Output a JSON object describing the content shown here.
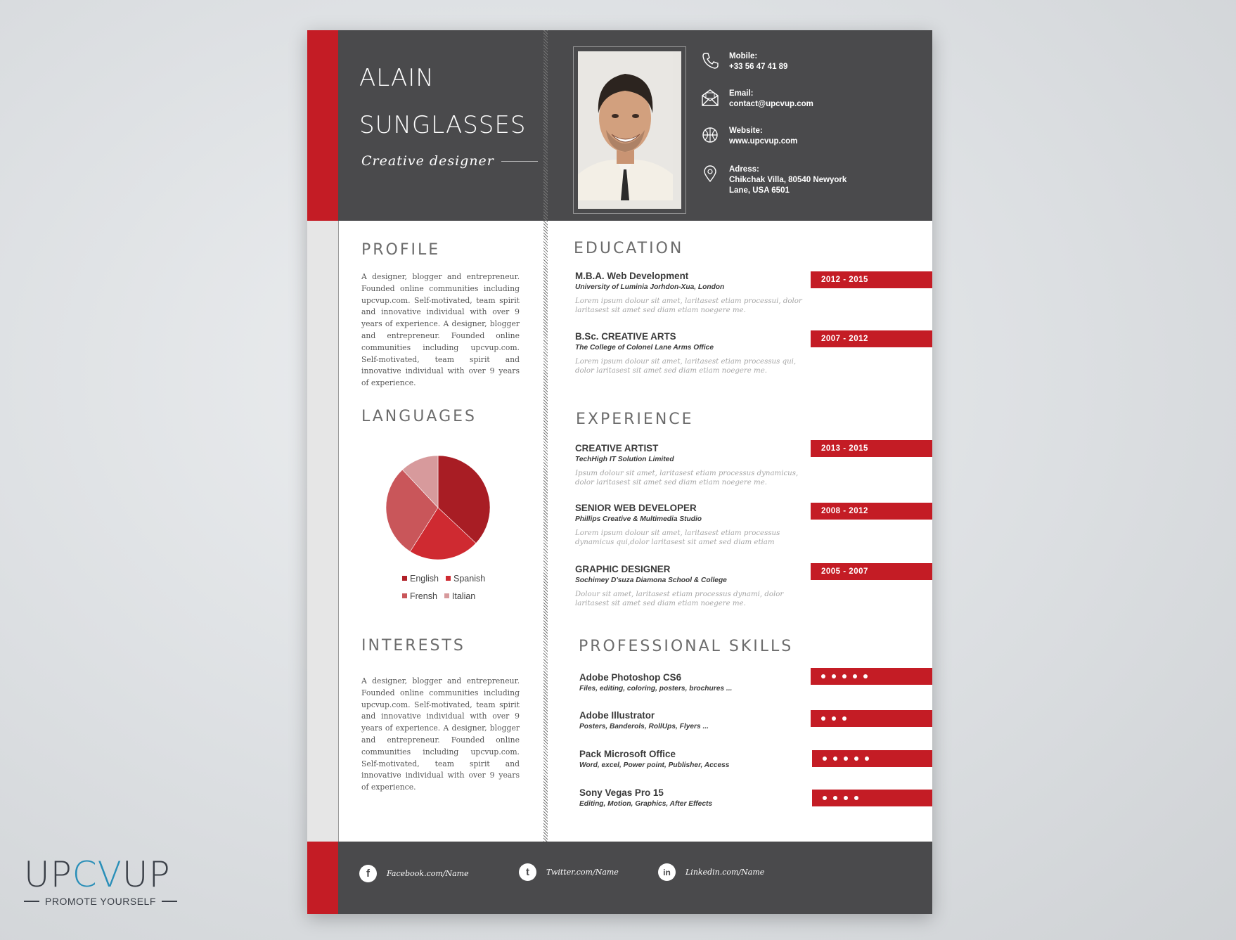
{
  "header": {
    "first_name": "ALAIN",
    "last_name": "SUNGLASSES",
    "role": "Creative designer"
  },
  "contact": [
    {
      "icon": "phone-icon",
      "label": "Mobile:",
      "value": "+33 56 47 41 89"
    },
    {
      "icon": "email-icon",
      "label": "Email:",
      "value": "contact@upcvup.com"
    },
    {
      "icon": "globe-icon",
      "label": "Website:",
      "value": "www.upcvup.com"
    },
    {
      "icon": "location-pin-icon",
      "label": "Adress:",
      "value": "Chikchak Villa, 80540 Newyork Lane, USA 6501"
    }
  ],
  "profile": {
    "title": "PROFILE",
    "text": "A designer, blogger and entrepreneur. Founded online communities including upcvup.com. Self-motivated, team spirit and innovative individual with over 9 years of experience. A designer, blogger and entrepreneur. Founded online communities including upcvup.com. Self-motivated, team spirit and innovative individual with over 9 years of experience."
  },
  "languages": {
    "title": "LANGUAGES",
    "legend": [
      "English",
      "Spanish",
      "Frensh",
      "Italian"
    ]
  },
  "chart_data": {
    "type": "pie",
    "categories": [
      "Spanish",
      "English",
      "Frensh",
      "Italian"
    ],
    "values": [
      37,
      22,
      29,
      12
    ],
    "colors": [
      "#a81d24",
      "#cf2a31",
      "#c9565a",
      "#d79a9c"
    ]
  },
  "interests": {
    "title": "INTERESTS",
    "text": "A designer, blogger and entrepreneur. Founded online communities including upcvup.com. Self-motivated, team spirit and innovative individual with over 9 years of experience. A designer, blogger and entrepreneur. Founded online communities including upcvup.com. Self-motivated, team spirit and innovative individual with over 9 years of experience."
  },
  "education": {
    "title": "EDUCATION",
    "items": [
      {
        "title": "M.B.A. Web Development",
        "org": "University of Luminia Jorhdon-Xua, London",
        "desc": "Lorem ipsum dolour sit amet, laritasest etiam processui, dolor laritasest  sit amet sed diam etiam noegere me.",
        "dates": "2012 - 2015"
      },
      {
        "title": "B.Sc. CREATIVE ARTS",
        "org": "The College of Colonel Lane Arms Office",
        "desc": "Lorem ipsum dolour sit amet, laritasest etiam processus qui, dolor laritasest  sit amet sed diam etiam noegere me.",
        "dates": "2007 - 2012"
      }
    ]
  },
  "experience": {
    "title": "EXPERIENCE",
    "items": [
      {
        "title": "CREATIVE ARTIST",
        "org": "TechHigh IT Solution Limited",
        "desc": "Ipsum dolour sit amet, laritasest etiam processus dynamicus, dolor laritasest  sit amet sed diam etiam noegere me.",
        "dates": "2013 - 2015"
      },
      {
        "title": "SENIOR WEB DEVELOPER",
        "org": "Phillips Creative & Multimedia Studio",
        "desc": "Lorem ipsum dolour sit amet, laritasest etiam processus dynamicus qui,dolor laritasest  sit amet sed diam etiam",
        "dates": "2008 - 2012"
      },
      {
        "title": "GRAPHIC DESIGNER",
        "org": "Sochimey D'suza Diamona School & College",
        "desc": "Dolour sit amet, laritasest etiam processus dynami, dolor laritasest  sit amet sed diam etiam noegere me.",
        "dates": "2005 - 2007"
      }
    ]
  },
  "skills": {
    "title": "PROFESSIONAL  SKILLS",
    "items": [
      {
        "name": "Adobe Photoshop CS6",
        "details": "Files, editing, coloring, posters, brochures ...",
        "level": 5
      },
      {
        "name": "Adobe Illustrator",
        "details": "Posters, Banderols, RollUps, Flyers ...",
        "level": 3
      },
      {
        "name": "Pack Microsoft Office",
        "details": "Word, excel, Power point, Publisher, Access",
        "level": 5
      },
      {
        "name": "Sony Vegas Pro 15",
        "details": "Editing, Motion, Graphics, After Effects",
        "level": 4
      }
    ]
  },
  "social": [
    {
      "icon": "facebook-icon",
      "glyph": "f",
      "label": "Facebook.com/Name"
    },
    {
      "icon": "twitter-icon",
      "glyph": "t",
      "label": "Twitter.com/Name"
    },
    {
      "icon": "linkedin-icon",
      "glyph": "in",
      "label": "Linkedin.com/Name"
    }
  ],
  "brand": {
    "logo_left": "UP",
    "logo_mid": "CV",
    "logo_right": "UP",
    "tagline": "PROMOTE YOURSELF"
  },
  "colors": {
    "accent": "#c41c25",
    "dark": "#4a4a4c"
  }
}
